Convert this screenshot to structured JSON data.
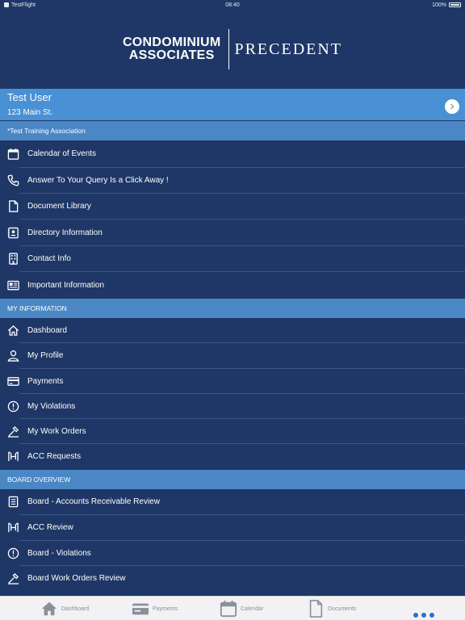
{
  "status_bar": {
    "carrier": "TestFlight",
    "time": "08:40",
    "battery": "100%"
  },
  "header": {
    "logo_line1": "CONDOMINIUM",
    "logo_line2": "ASSOCIATES",
    "logo_brand": "PRECEDENT"
  },
  "user": {
    "name": "Test User",
    "address": "123 Main St."
  },
  "sections": {
    "association": "*Test Training Association",
    "my_information": "MY INFORMATION",
    "board_overview": "BOARD OVERVIEW"
  },
  "association_items": [
    {
      "label": "Calendar of Events",
      "icon": "calendar-icon"
    },
    {
      "label": "Answer To Your Query Is a Click Away !",
      "icon": "phone-icon"
    },
    {
      "label": "Document Library",
      "icon": "document-icon"
    },
    {
      "label": "Directory Information",
      "icon": "contact-card-icon"
    },
    {
      "label": "Contact Info",
      "icon": "building-icon"
    },
    {
      "label": "Important Information",
      "icon": "newspaper-icon"
    }
  ],
  "my_information_items": [
    {
      "label": "Dashboard",
      "icon": "home-icon"
    },
    {
      "label": "My Profile",
      "icon": "person-icon"
    },
    {
      "label": "Payments",
      "icon": "credit-card-icon"
    },
    {
      "label": "My Violations",
      "icon": "alert-icon"
    },
    {
      "label": "My Work Orders",
      "icon": "tools-icon"
    },
    {
      "label": "ACC Requests",
      "icon": "acc-icon"
    }
  ],
  "board_items": [
    {
      "label": "Board - Accounts Receivable Review",
      "icon": "ledger-icon"
    },
    {
      "label": "ACC Review",
      "icon": "acc-icon"
    },
    {
      "label": "Board - Violations",
      "icon": "alert-icon"
    },
    {
      "label": "Board Work Orders Review",
      "icon": "tools-icon"
    }
  ],
  "tab_bar": {
    "dashboard": "Dashboard",
    "payments": "Payments",
    "calendar": "Calendar",
    "documents": "Documents"
  },
  "colors": {
    "background": "#1e3766",
    "user_banner": "#4a90d4",
    "section_header": "#4a87c4",
    "tab_active": "#2c6fc4"
  }
}
